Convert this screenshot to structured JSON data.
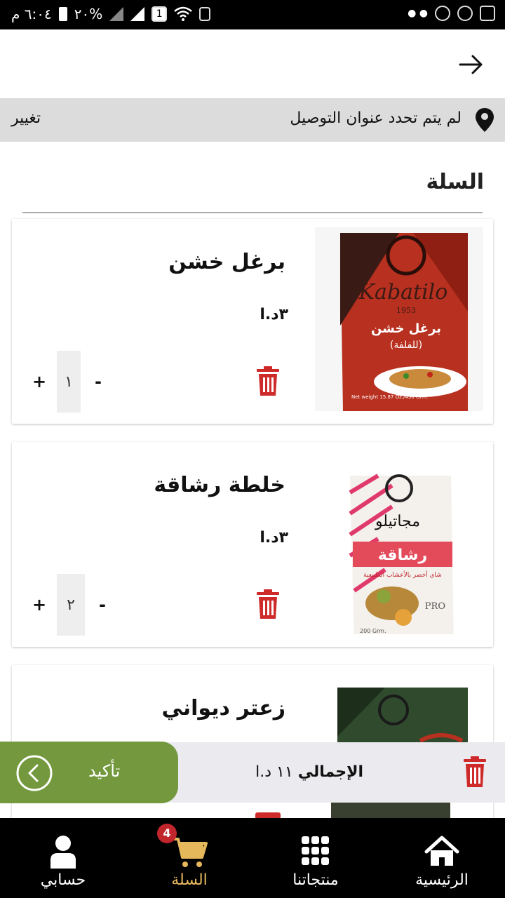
{
  "status_bar": {
    "time": "٦:٠٤ م",
    "battery": "٢٠%",
    "sim": "1"
  },
  "address": {
    "text": "لم يتم تحدد عنوان التوصيل",
    "change_label": "تغيير"
  },
  "page": {
    "title": "السلة"
  },
  "cart_items": [
    {
      "name": "برغل خشن",
      "price": "٣د.ا",
      "quantity": "١"
    },
    {
      "name": "خلطة رشاقة",
      "price": "٣د.ا",
      "quantity": "٢"
    },
    {
      "name": "زعتر ديواني"
    }
  ],
  "quantity_controls": {
    "plus": "+",
    "minus": "-"
  },
  "product_images": [
    {
      "brand": "Kabatilo",
      "year": "1953",
      "title": "برغل خشن",
      "subtitle": "(للفلفة)",
      "weight": "Net weight 15.87 Oz./450 Grm."
    },
    {
      "title": "رشاقة",
      "subtitle": "شاي أخضر بالأعشاب الطبيعية",
      "mark": "PRO",
      "weight": "200 Grm."
    }
  ],
  "total": {
    "label": "الإجمالي",
    "value": "١١ د.ا"
  },
  "confirm_button": {
    "label": "تأكيد"
  },
  "bottom_nav": {
    "home": "الرئيسية",
    "products": "منتجاتنا",
    "cart": "السلة",
    "account": "حسابي",
    "cart_badge": "4"
  },
  "colors": {
    "accent_green": "#73983d",
    "cart_active": "#e6b85c",
    "trash_red": "#cf2a2a",
    "badge_red": "#c0262c"
  }
}
